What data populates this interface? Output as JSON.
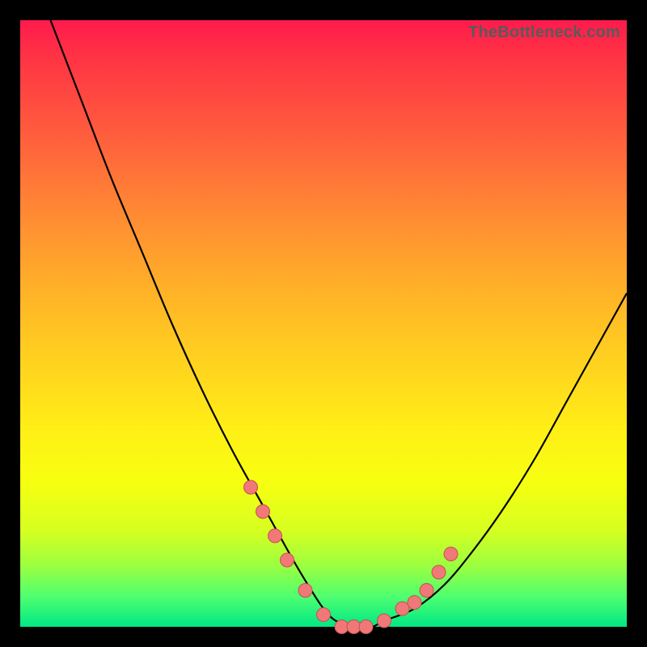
{
  "watermark": "TheBottleneck.com",
  "colors": {
    "background": "#000000",
    "gradient_top": "#ff1a4d",
    "gradient_bottom": "#00e884",
    "curve": "#000000",
    "marker_fill": "#f07878",
    "marker_stroke": "#c94f4f"
  },
  "chart_data": {
    "type": "line",
    "title": "",
    "xlabel": "",
    "ylabel": "",
    "xlim": [
      0,
      100
    ],
    "ylim": [
      0,
      100
    ],
    "grid": false,
    "legend": false,
    "series": [
      {
        "name": "bottleneck-curve",
        "x": [
          5,
          10,
          15,
          20,
          25,
          30,
          35,
          40,
          45,
          48,
          50,
          52,
          55,
          58,
          60,
          65,
          70,
          75,
          80,
          85,
          90,
          95,
          100
        ],
        "values": [
          100,
          87,
          74,
          62,
          50,
          39,
          29,
          20,
          11,
          6,
          3,
          1,
          0,
          0,
          1,
          3,
          7,
          13,
          20,
          28,
          37,
          46,
          55
        ]
      }
    ],
    "markers": {
      "name": "highlight-points",
      "x": [
        38,
        40,
        42,
        44,
        47,
        50,
        53,
        55,
        57,
        60,
        63,
        65,
        67,
        69,
        71
      ],
      "values": [
        23,
        19,
        15,
        11,
        6,
        2,
        0,
        0,
        0,
        1,
        3,
        4,
        6,
        9,
        12
      ]
    }
  }
}
